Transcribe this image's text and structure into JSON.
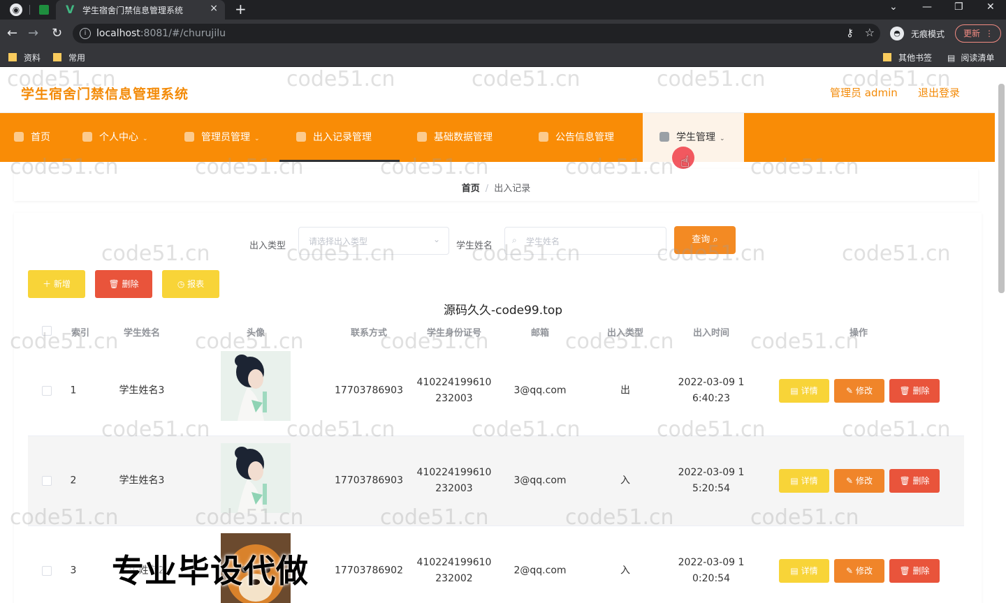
{
  "browser": {
    "tab_title": "学生宿舍门禁信息管理系统",
    "tab_close": "×",
    "new_tab": "+",
    "url_host": "localhost",
    "url_path": ":8081/#/churujilu",
    "incognito_label": "无痕模式",
    "update_label": "更新",
    "bookmarks": [
      "资料",
      "常用"
    ],
    "bookmarks_right": [
      "其他书签",
      "阅读清单"
    ]
  },
  "header": {
    "site_title": "学生宿舍门禁信息管理系统",
    "admin_label": "管理员 admin",
    "logout_label": "退出登录"
  },
  "menu": [
    {
      "label": "首页"
    },
    {
      "label": "个人中心"
    },
    {
      "label": "管理员管理"
    },
    {
      "label": "出入记录管理"
    },
    {
      "label": "基础数据管理"
    },
    {
      "label": "公告信息管理"
    },
    {
      "label": "学生管理"
    }
  ],
  "breadcrumb": {
    "home": "首页",
    "sep": "/",
    "current": "出入记录"
  },
  "search": {
    "type_label": "出入类型",
    "type_placeholder": "请选择出入类型",
    "name_label": "学生姓名",
    "name_placeholder": "学生姓名",
    "query_label": "查询"
  },
  "actions": {
    "add": "新增",
    "delete": "删除",
    "report": "报表"
  },
  "caption": "源码久久-code99.top",
  "table": {
    "headers": [
      "索引",
      "学生姓名",
      "头像",
      "联系方式",
      "学生身份证号",
      "邮箱",
      "出入类型",
      "出入时间",
      "操作"
    ],
    "rows": [
      {
        "index": "1",
        "name": "学生姓名3",
        "phone": "17703786903",
        "id1": "410224199610",
        "id2": "232003",
        "email": "3@qq.com",
        "type": "出",
        "time1": "2022-03-09 1",
        "time2": "6:40:23"
      },
      {
        "index": "2",
        "name": "学生姓名3",
        "phone": "17703786903",
        "id1": "410224199610",
        "id2": "232003",
        "email": "3@qq.com",
        "type": "入",
        "time1": "2022-03-09 1",
        "time2": "5:20:54"
      },
      {
        "index": "3",
        "name": "学生姓名2",
        "phone": "17703786902",
        "id1": "410224199610",
        "id2": "232002",
        "email": "2@qq.com",
        "type": "入",
        "time1": "2022-03-09 1",
        "time2": "0:20:54"
      }
    ],
    "row_buttons": {
      "detail": "详情",
      "edit": "修改",
      "delete": "删除"
    }
  },
  "overlay_text": "专业毕设代做",
  "watermark": "code51.cn",
  "colors": {
    "accent": "#f98c06",
    "title": "#f38a07",
    "yellow": "#f8d438",
    "red": "#e9543b",
    "orange": "#f0852a"
  }
}
